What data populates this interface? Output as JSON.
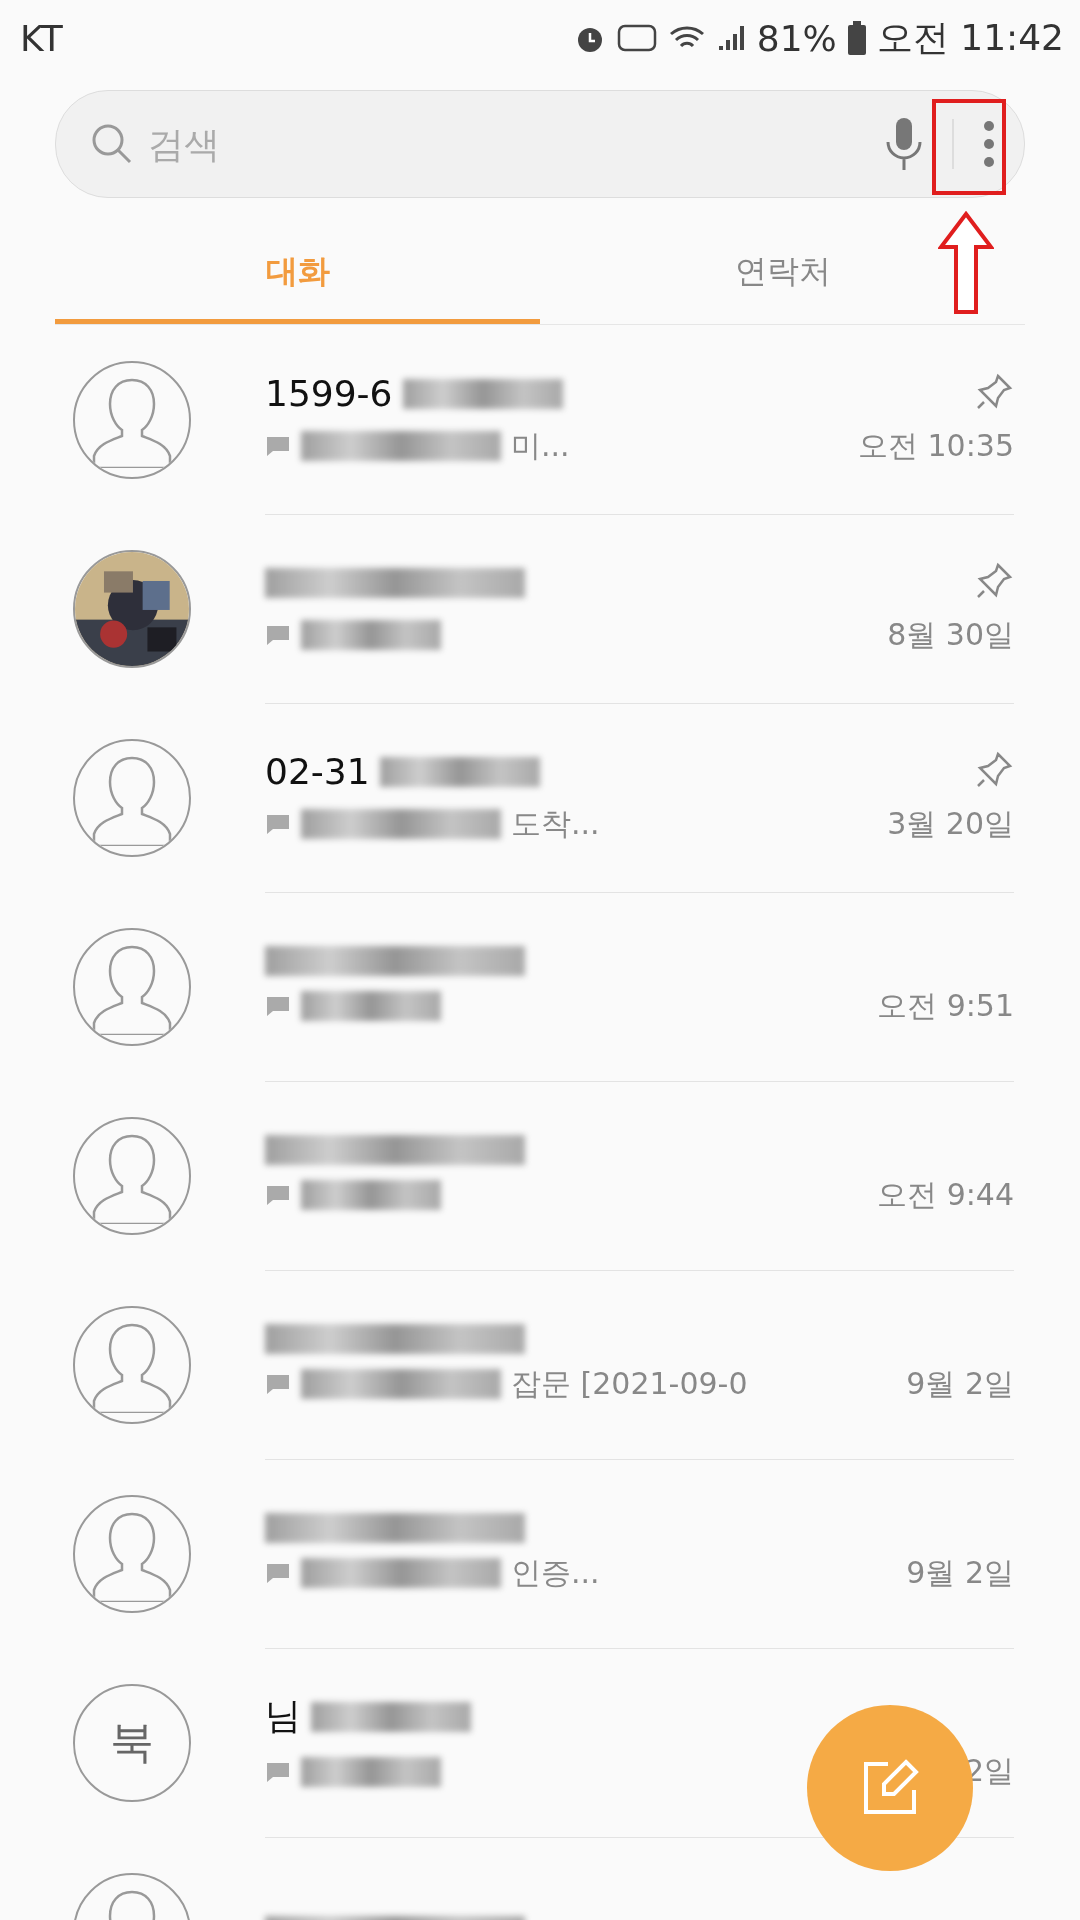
{
  "status_bar": {
    "carrier": "KT",
    "battery": "81%",
    "time": "오전 11:42"
  },
  "search": {
    "placeholder": "검색"
  },
  "annotation": {
    "kind": "highlight"
  },
  "tabs": [
    {
      "label": "대화",
      "selected": true
    },
    {
      "label": "연락처",
      "selected": false
    }
  ],
  "conversations": [
    {
      "kind": "silhouette",
      "name": "1599-6",
      "redacted": true,
      "preview": "미...",
      "time": "오전 10:35",
      "pinned": true
    },
    {
      "kind": "picture",
      "redacted": true,
      "time": "8월 30일",
      "pinned": true
    },
    {
      "kind": "silhouette",
      "name": "02-31",
      "redacted": true,
      "preview": "도착...",
      "time": "3월 20일",
      "pinned": true
    },
    {
      "kind": "silhouette",
      "redacted": true,
      "time": "오전 9:51",
      "pinned": false
    },
    {
      "kind": "silhouette",
      "redacted": true,
      "time": "오전 9:44",
      "pinned": false
    },
    {
      "kind": "silhouette",
      "redacted": true,
      "preview": "잡문 [2021-09-0",
      "time": "9월 2일",
      "pinned": false
    },
    {
      "kind": "silhouette",
      "redacted": true,
      "preview": "인증...",
      "time": "9월 2일",
      "pinned": false
    },
    {
      "kind": "letter",
      "letter": "북",
      "name": "님",
      "redacted": true,
      "time": "2일",
      "pinned": false
    },
    {
      "kind": "silhouette",
      "redacted": true
    }
  ],
  "compose_button": {
    "kind": "fab"
  }
}
